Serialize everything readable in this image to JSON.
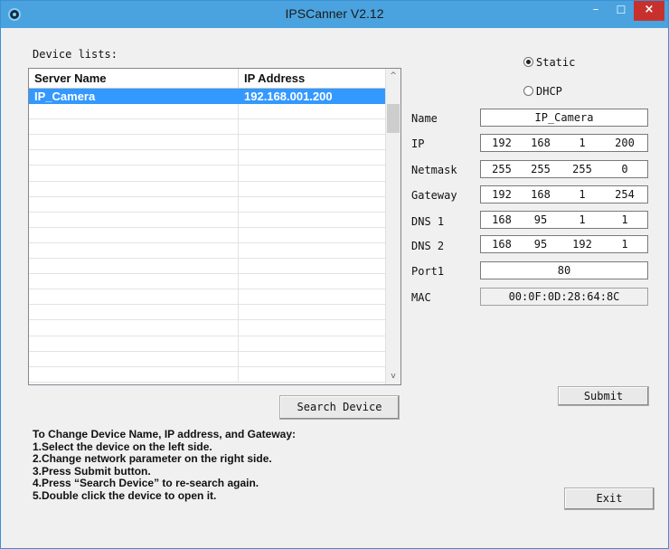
{
  "window": {
    "title": "IPSCanner V2.12",
    "minimize": "–",
    "maximize": "☐",
    "close": "×"
  },
  "device_list": {
    "label": "Device lists:",
    "columns": [
      "Server Name",
      "IP Address"
    ],
    "rows": [
      {
        "name": "IP_Camera",
        "ip": "192.168.001.200",
        "selected": true
      }
    ],
    "scroll_up": "^",
    "scroll_down": "v"
  },
  "buttons": {
    "search": "Search Device",
    "submit": "Submit",
    "exit": "Exit"
  },
  "mode": {
    "static_label": "Static",
    "dhcp_label": "DHCP",
    "selected": "Static"
  },
  "fields": {
    "name": {
      "label": "Name",
      "value": "IP_Camera"
    },
    "ip": {
      "label": "IP",
      "octets": [
        "192",
        "168",
        "1",
        "200"
      ]
    },
    "netmask": {
      "label": "Netmask",
      "octets": [
        "255",
        "255",
        "255",
        "0"
      ]
    },
    "gateway": {
      "label": "Gateway",
      "octets": [
        "192",
        "168",
        "1",
        "254"
      ]
    },
    "dns1": {
      "label": "DNS 1",
      "octets": [
        "168",
        "95",
        "1",
        "1"
      ]
    },
    "dns2": {
      "label": "DNS 2",
      "octets": [
        "168",
        "95",
        "192",
        "1"
      ]
    },
    "port1": {
      "label": "Port1",
      "value": "80"
    },
    "mac": {
      "label": "MAC",
      "value": "00:0F:0D:28:64:8C"
    }
  },
  "instructions": [
    "To Change Device Name, IP address, and Gateway:",
    "1.Select the device on the left side.",
    "2.Change network parameter on the right side.",
    "3.Press Submit button.",
    "4.Press “Search Device” to re-search again.",
    "5.Double click the device to open it."
  ],
  "colors": {
    "titlebar": "#4aa3df",
    "selection": "#3399ff",
    "close_button": "#c7312d"
  }
}
